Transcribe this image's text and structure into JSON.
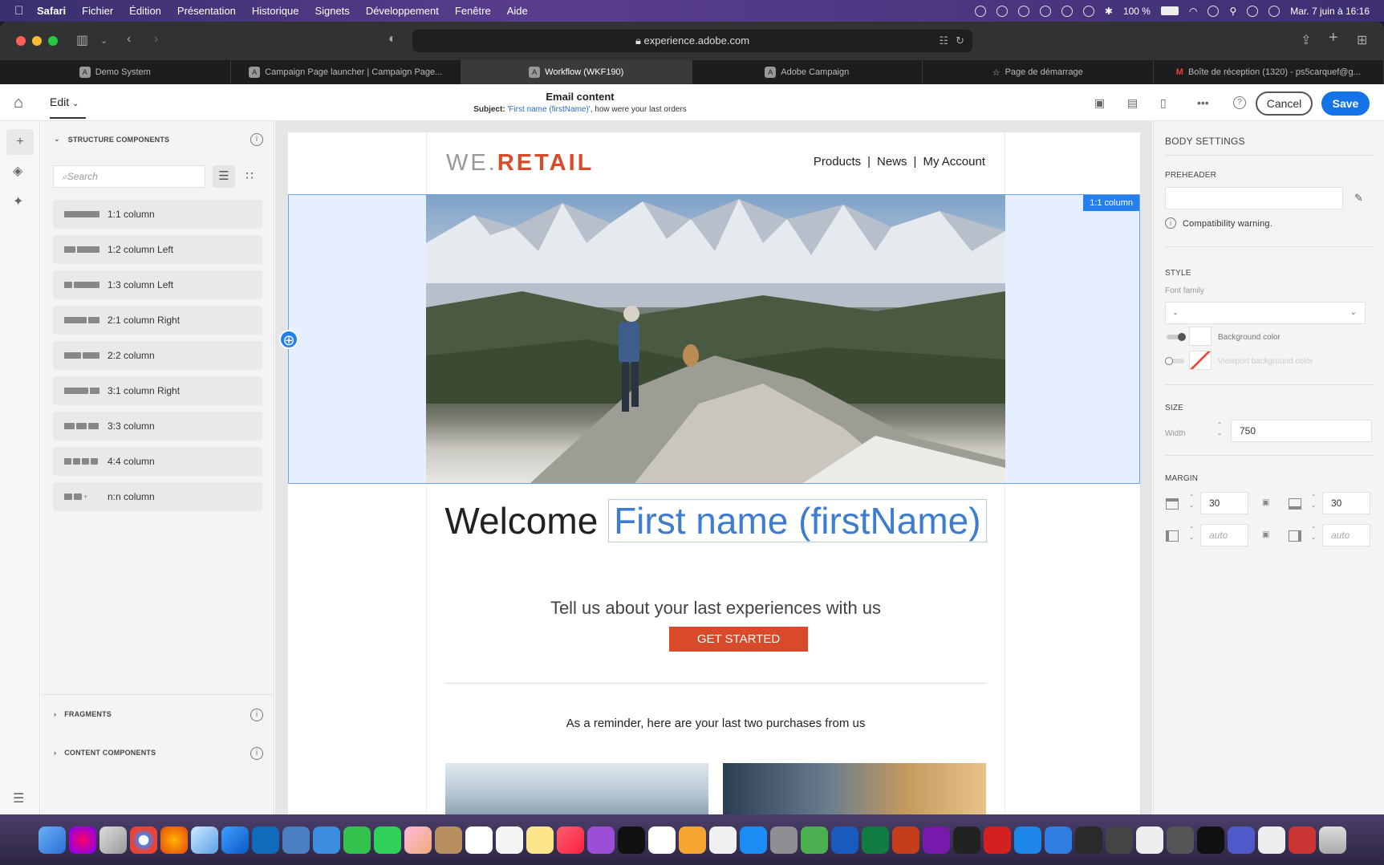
{
  "menubar": {
    "app_name": "Safari",
    "items": [
      "Fichier",
      "Édition",
      "Présentation",
      "Historique",
      "Signets",
      "Développement",
      "Fenêtre",
      "Aide"
    ],
    "battery": "100 %",
    "datetime": "Mar. 7 juin à 16:16"
  },
  "browser": {
    "url": "experience.adobe.com",
    "tabs": [
      {
        "label": "Demo System",
        "active": false
      },
      {
        "label": "Campaign Page launcher | Campaign Page...",
        "active": false
      },
      {
        "label": "Workflow (WKF190)",
        "active": true
      },
      {
        "label": "Adobe Campaign",
        "active": false
      },
      {
        "label": "Page de démarrage",
        "active": false
      },
      {
        "label": "Boîte de réception (1320) - ps5carquef@g...",
        "active": false
      }
    ]
  },
  "header": {
    "edit_label": "Edit",
    "title": "Email content",
    "subject_label": "Subject:",
    "subject_token": "'First name (firstName)'",
    "subject_text": ", how were your last orders",
    "cancel_label": "Cancel",
    "save_label": "Save"
  },
  "left_panel": {
    "structure_header": "STRUCTURE COMPONENTS",
    "search_placeholder": "Search",
    "components": [
      {
        "label": "1:1 column"
      },
      {
        "label": "1:2 column Left"
      },
      {
        "label": "1:3 column Left"
      },
      {
        "label": "2:1 column Right"
      },
      {
        "label": "2:2 column"
      },
      {
        "label": "3:1 column Right"
      },
      {
        "label": "3:3 column"
      },
      {
        "label": "4:4 column"
      },
      {
        "label": "n:n column"
      }
    ],
    "fragments_header": "FRAGMENTS",
    "content_header": "CONTENT COMPONENTS"
  },
  "email": {
    "logo_prefix": "WE.",
    "logo_suffix": "RETAIL",
    "nav": [
      "Products",
      "|",
      "News",
      "|",
      "My Account"
    ],
    "selection_label": "1:1 column",
    "welcome": "Welcome",
    "firstname_token": "First name (firstName)",
    "tagline": "Tell us about your last experiences with us",
    "cta": "GET STARTED",
    "reminder": "As a reminder, here are your last two purchases from us"
  },
  "right_panel": {
    "title": "BODY SETTINGS",
    "preheader_label": "PREHEADER",
    "compat_warning": "Compatibility warning.",
    "style_label": "STYLE",
    "font_family_label": "Font family",
    "font_family_value": "-",
    "bg_color_label": "Background color",
    "viewport_bg_label": "Viewport background color",
    "size_label": "SIZE",
    "width_label": "Width",
    "width_value": "750",
    "margin_label": "MARGIN",
    "margin_top": "30",
    "margin_bottom": "30",
    "margin_left": "auto",
    "margin_right": "auto"
  },
  "colors": {
    "accent": "#1473e6",
    "brand_red": "#d94a2b",
    "selection": "#2680eb"
  }
}
